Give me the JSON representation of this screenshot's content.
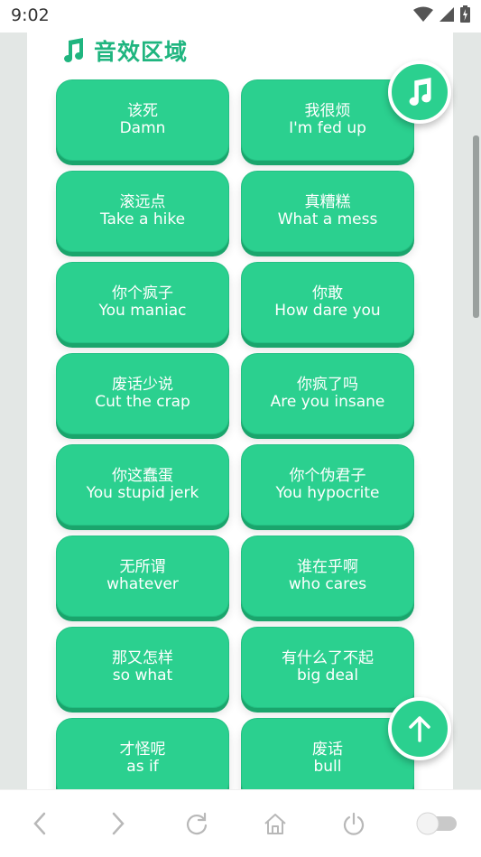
{
  "status_bar": {
    "time": "9:02"
  },
  "section": {
    "title": "音效区域",
    "icon": "music-note-icon"
  },
  "sounds": [
    {
      "cn": "该死",
      "en": "Damn"
    },
    {
      "cn": "我很烦",
      "en": "I'm fed up"
    },
    {
      "cn": "滚远点",
      "en": "Take a hike"
    },
    {
      "cn": "真糟糕",
      "en": "What a mess"
    },
    {
      "cn": "你个疯子",
      "en": "You maniac"
    },
    {
      "cn": "你敢",
      "en": "How dare you"
    },
    {
      "cn": "废话少说",
      "en": "Cut the crap"
    },
    {
      "cn": "你疯了吗",
      "en": "Are you insane"
    },
    {
      "cn": "你这蠢蛋",
      "en": "You stupid jerk"
    },
    {
      "cn": "你个伪君子",
      "en": "You hypocrite"
    },
    {
      "cn": "无所谓",
      "en": "whatever"
    },
    {
      "cn": "谁在乎啊",
      "en": "who cares"
    },
    {
      "cn": "那又怎样",
      "en": "so what"
    },
    {
      "cn": "有什么了不起",
      "en": "big deal"
    },
    {
      "cn": "才怪呢",
      "en": "as if"
    },
    {
      "cn": "废话",
      "en": "bull"
    }
  ],
  "colors": {
    "accent": "#2bd08f",
    "accent_dark": "#1aa56c",
    "title": "#1fb57f",
    "background": "#e3e7e5"
  },
  "fabs": {
    "music": "music-note-icon",
    "scroll_top": "arrow-up-icon"
  },
  "bottom_nav": [
    {
      "name": "back-icon"
    },
    {
      "name": "forward-icon"
    },
    {
      "name": "reload-icon"
    },
    {
      "name": "home-icon"
    },
    {
      "name": "power-icon"
    },
    {
      "name": "toggle-switch"
    }
  ]
}
